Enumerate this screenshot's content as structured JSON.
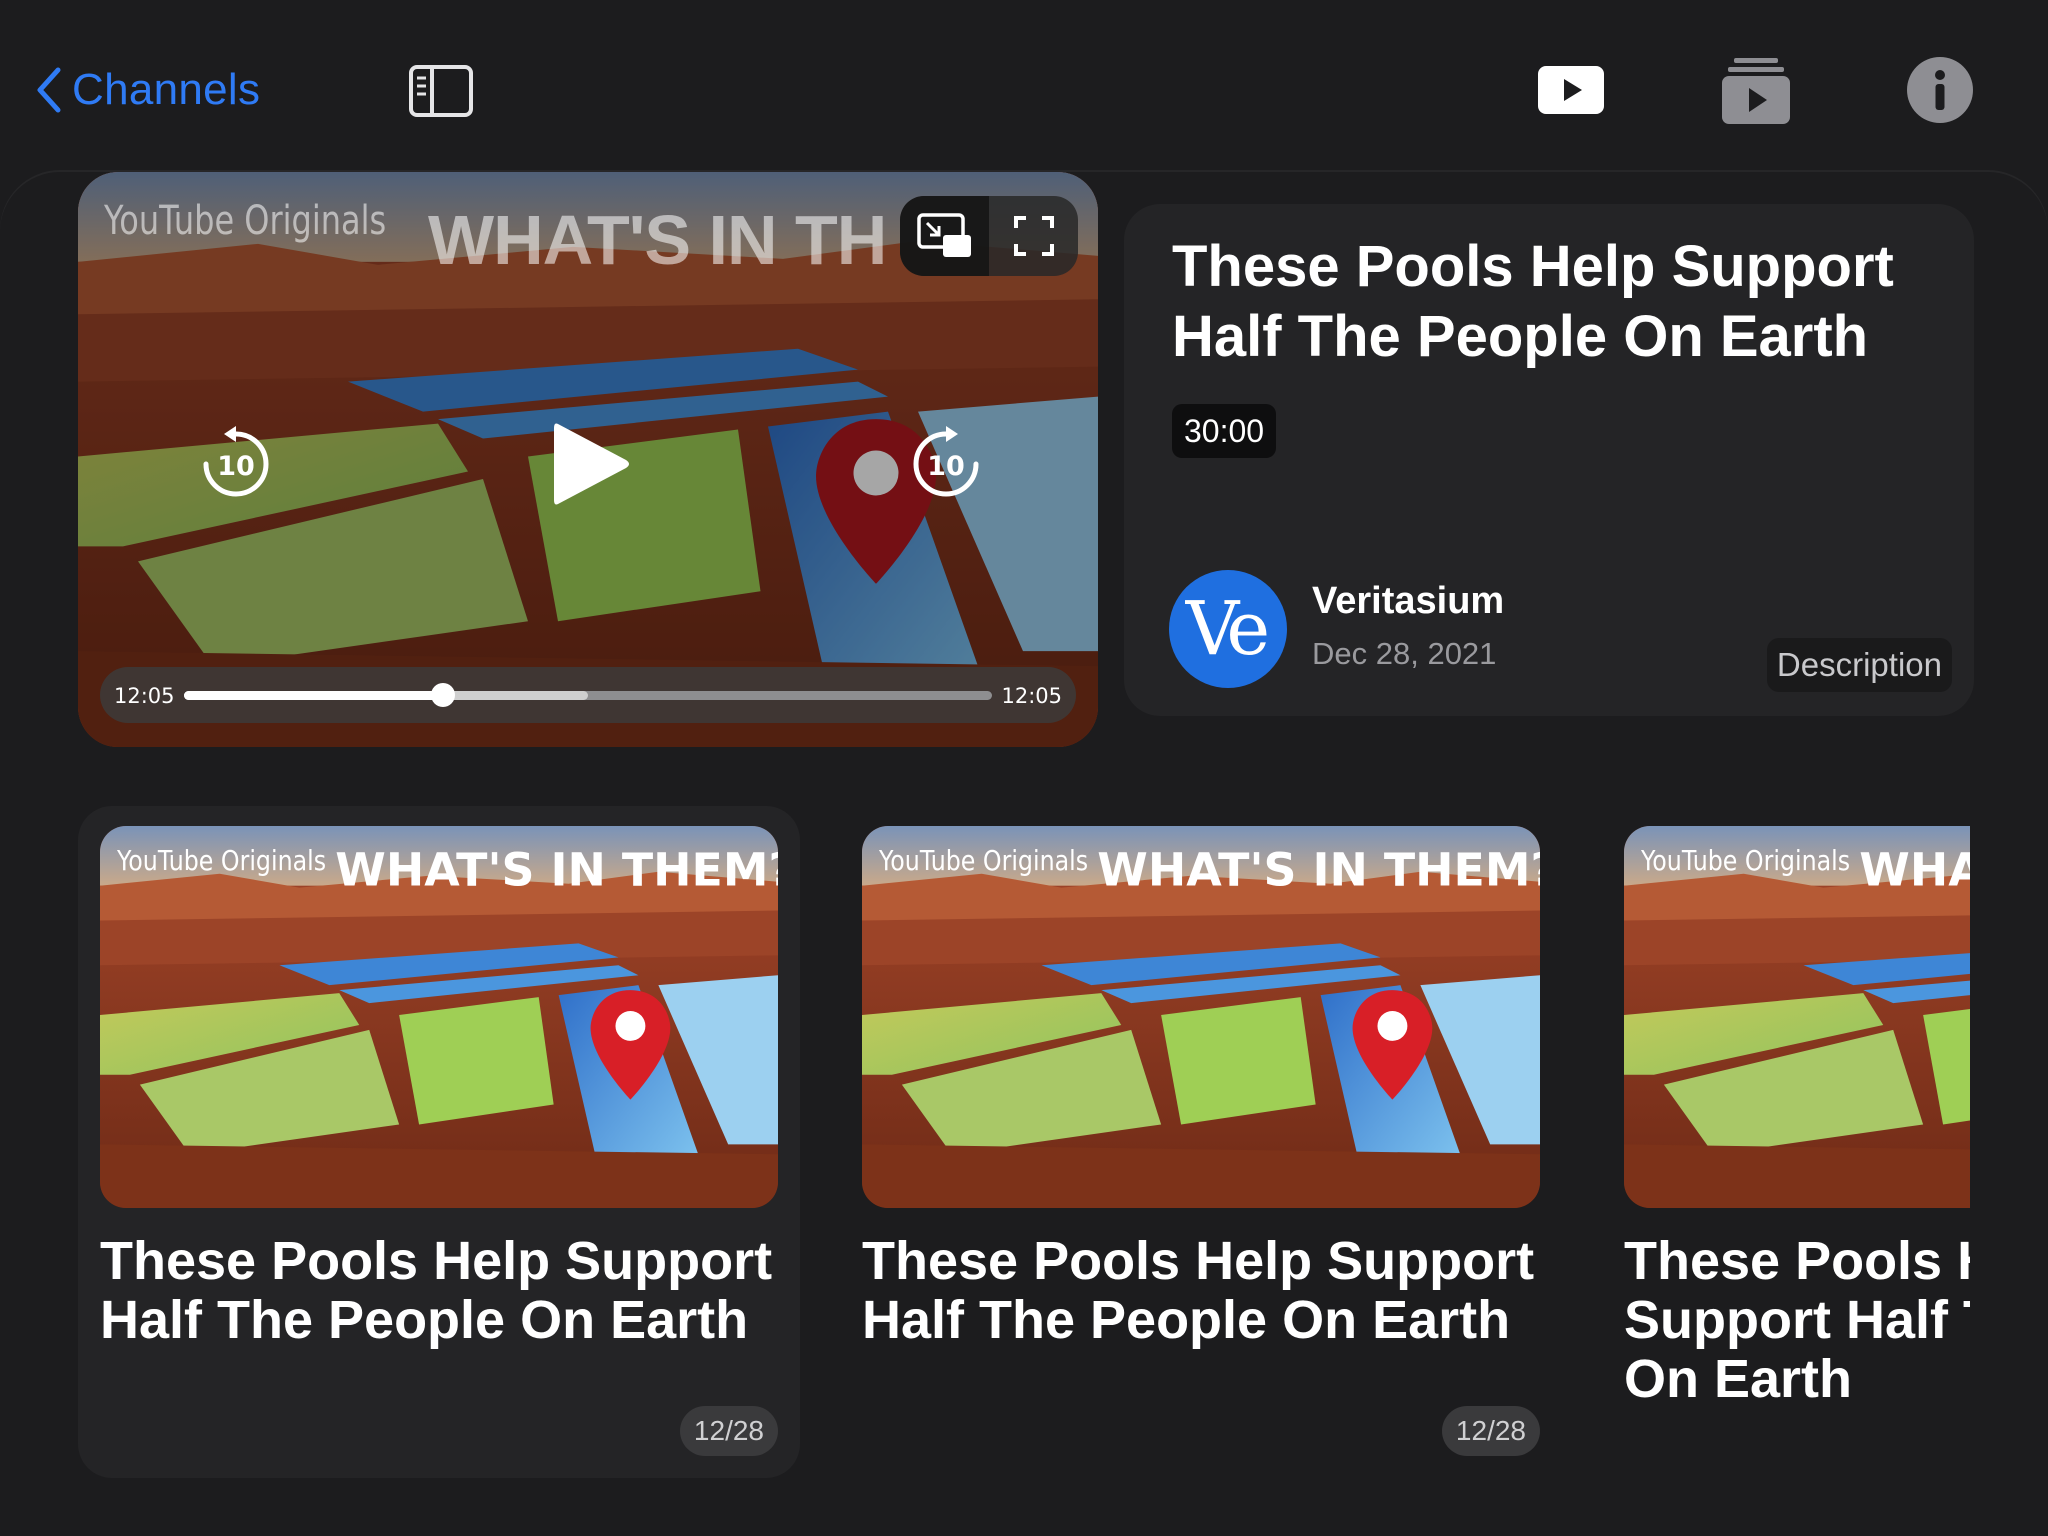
{
  "nav": {
    "back_label": "Channels",
    "icons": [
      "chevron-left-icon",
      "sidebar-icon",
      "play-rectangle-icon",
      "queue-icon",
      "info-circle-icon"
    ],
    "accent_color": "#2f7bf5"
  },
  "player": {
    "overlay_brand": "YouTube Originals",
    "overlay_title": "WHAT'S IN TH",
    "skip_back_seconds": "10",
    "skip_forward_seconds": "10",
    "elapsed": "12:05",
    "remaining": "12:05",
    "progress_fraction": 0.32,
    "buffered_fraction": 0.5
  },
  "video": {
    "title": "These Pools Help Support Half The People On Earth",
    "duration": "30:00",
    "channel_initials": "Ve",
    "channel_name": "Veritasium",
    "date": "Dec 28, 2021",
    "description_label": "Description",
    "avatar_color": "#1f6fe0"
  },
  "list": {
    "items": [
      {
        "brand": "YouTube Originals",
        "thumb_title": "WHAT'S IN THEM?",
        "title": "These Pools Help Support Half The People On Earth",
        "date": "12/28"
      },
      {
        "brand": "YouTube Originals",
        "thumb_title": "WHAT'S IN THEM?",
        "title": "These Pools Help Support Half The People On Earth",
        "date": "12/28"
      },
      {
        "brand": "YouTube Originals",
        "thumb_title": "WHA",
        "title": "These Pools H Support Half T On Earth",
        "date": ""
      }
    ]
  }
}
